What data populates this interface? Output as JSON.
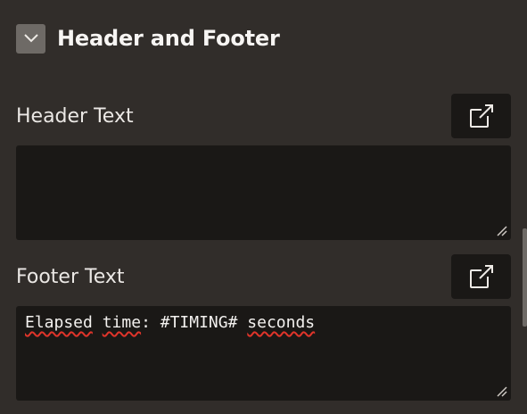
{
  "section": {
    "title": "Header and Footer",
    "toggle_icon": "chevron-down-icon"
  },
  "header_text": {
    "label": "Header Text",
    "value": "",
    "expand_icon": "expand-arrow-icon"
  },
  "footer_text": {
    "label": "Footer Text",
    "value_parts": [
      "Elapsed",
      " ",
      "time",
      ": #TIMING# ",
      "seconds"
    ],
    "expand_icon": "expand-arrow-icon"
  },
  "colors": {
    "panel_bg": "#312d2a",
    "field_bg": "#1a1816",
    "toggle_bg": "#6e6a66",
    "spellcheck_underline": "#e0342a"
  }
}
